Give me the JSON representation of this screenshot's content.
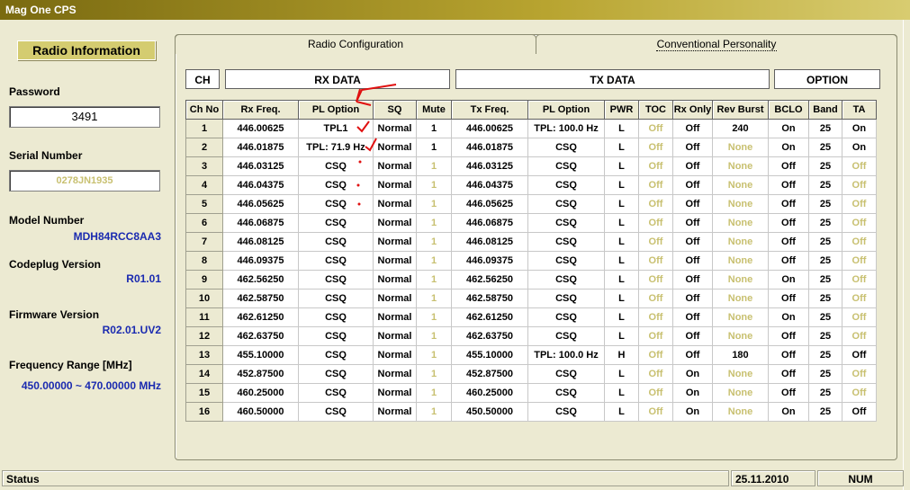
{
  "app": {
    "title": "Mag One CPS"
  },
  "sidebar": {
    "heading": "Radio Information",
    "password_label": "Password",
    "password_value": "3491",
    "serial_label": "Serial Number",
    "serial_value": "0278JN1935",
    "model_label": "Model Number",
    "model_value": "MDH84RCC8AA3",
    "codeplug_label": "Codeplug Version",
    "codeplug_value": "R01.01",
    "firmware_label": "Firmware Version",
    "firmware_value": "R02.01.UV2",
    "freq_label": "Frequency Range [MHz]",
    "freq_value": "450.00000 ~ 470.00000 MHz"
  },
  "tabs": {
    "radio_config": "Radio Configuration",
    "conv_personality": "Conventional Personality"
  },
  "groups": {
    "ch": "CH",
    "rx": "RX DATA",
    "tx": "TX DATA",
    "option": "OPTION"
  },
  "columns": [
    "Ch No",
    "Rx Freq.",
    "PL Option",
    "SQ",
    "Mute",
    "Tx Freq.",
    "PL Option",
    "PWR",
    "TOC",
    "Rx Only",
    "Rev Burst",
    "BCLO",
    "Band",
    "TA"
  ],
  "rows": [
    [
      "1",
      "446.00625",
      "TPL1",
      "Normal",
      "1",
      "446.00625",
      "TPL: 100.0 Hz",
      "L",
      "Off",
      "Off",
      "240",
      "On",
      "25",
      "On"
    ],
    [
      "2",
      "446.01875",
      "TPL: 71.9 Hz",
      "Normal",
      "1",
      "446.01875",
      "CSQ",
      "L",
      "Off",
      "Off",
      "None",
      "On",
      "25",
      "On"
    ],
    [
      "3",
      "446.03125",
      "CSQ",
      "Normal",
      "1",
      "446.03125",
      "CSQ",
      "L",
      "Off",
      "Off",
      "None",
      "Off",
      "25",
      "Off"
    ],
    [
      "4",
      "446.04375",
      "CSQ",
      "Normal",
      "1",
      "446.04375",
      "CSQ",
      "L",
      "Off",
      "Off",
      "None",
      "Off",
      "25",
      "Off"
    ],
    [
      "5",
      "446.05625",
      "CSQ",
      "Normal",
      "1",
      "446.05625",
      "CSQ",
      "L",
      "Off",
      "Off",
      "None",
      "Off",
      "25",
      "Off"
    ],
    [
      "6",
      "446.06875",
      "CSQ",
      "Normal",
      "1",
      "446.06875",
      "CSQ",
      "L",
      "Off",
      "Off",
      "None",
      "Off",
      "25",
      "Off"
    ],
    [
      "7",
      "446.08125",
      "CSQ",
      "Normal",
      "1",
      "446.08125",
      "CSQ",
      "L",
      "Off",
      "Off",
      "None",
      "Off",
      "25",
      "Off"
    ],
    [
      "8",
      "446.09375",
      "CSQ",
      "Normal",
      "1",
      "446.09375",
      "CSQ",
      "L",
      "Off",
      "Off",
      "None",
      "Off",
      "25",
      "Off"
    ],
    [
      "9",
      "462.56250",
      "CSQ",
      "Normal",
      "1",
      "462.56250",
      "CSQ",
      "L",
      "Off",
      "Off",
      "None",
      "On",
      "25",
      "Off"
    ],
    [
      "10",
      "462.58750",
      "CSQ",
      "Normal",
      "1",
      "462.58750",
      "CSQ",
      "L",
      "Off",
      "Off",
      "None",
      "Off",
      "25",
      "Off"
    ],
    [
      "11",
      "462.61250",
      "CSQ",
      "Normal",
      "1",
      "462.61250",
      "CSQ",
      "L",
      "Off",
      "Off",
      "None",
      "On",
      "25",
      "Off"
    ],
    [
      "12",
      "462.63750",
      "CSQ",
      "Normal",
      "1",
      "462.63750",
      "CSQ",
      "L",
      "Off",
      "Off",
      "None",
      "Off",
      "25",
      "Off"
    ],
    [
      "13",
      "455.10000",
      "CSQ",
      "Normal",
      "1",
      "455.10000",
      "TPL: 100.0 Hz",
      "H",
      "Off",
      "Off",
      "180",
      "Off",
      "25",
      "Off"
    ],
    [
      "14",
      "452.87500",
      "CSQ",
      "Normal",
      "1",
      "452.87500",
      "CSQ",
      "L",
      "Off",
      "On",
      "None",
      "Off",
      "25",
      "Off"
    ],
    [
      "15",
      "460.25000",
      "CSQ",
      "Normal",
      "1",
      "460.25000",
      "CSQ",
      "L",
      "Off",
      "On",
      "None",
      "Off",
      "25",
      "Off"
    ],
    [
      "16",
      "460.50000",
      "CSQ",
      "Normal",
      "1",
      "450.50000",
      "CSQ",
      "L",
      "Off",
      "On",
      "None",
      "On",
      "25",
      "Off"
    ]
  ],
  "dim_cells": [
    [
      false,
      false,
      false,
      false,
      false,
      false,
      false,
      false,
      true,
      false,
      false,
      false,
      false,
      false
    ],
    [
      false,
      false,
      false,
      false,
      false,
      false,
      false,
      false,
      true,
      false,
      true,
      false,
      false,
      false
    ],
    [
      false,
      false,
      false,
      false,
      true,
      false,
      false,
      false,
      true,
      false,
      true,
      false,
      false,
      true
    ],
    [
      false,
      false,
      false,
      false,
      true,
      false,
      false,
      false,
      true,
      false,
      true,
      false,
      false,
      true
    ],
    [
      false,
      false,
      false,
      false,
      true,
      false,
      false,
      false,
      true,
      false,
      true,
      false,
      false,
      true
    ],
    [
      false,
      false,
      false,
      false,
      true,
      false,
      false,
      false,
      true,
      false,
      true,
      false,
      false,
      true
    ],
    [
      false,
      false,
      false,
      false,
      true,
      false,
      false,
      false,
      true,
      false,
      true,
      false,
      false,
      true
    ],
    [
      false,
      false,
      false,
      false,
      true,
      false,
      false,
      false,
      true,
      false,
      true,
      false,
      false,
      true
    ],
    [
      false,
      false,
      false,
      false,
      true,
      false,
      false,
      false,
      true,
      false,
      true,
      false,
      false,
      true
    ],
    [
      false,
      false,
      false,
      false,
      true,
      false,
      false,
      false,
      true,
      false,
      true,
      false,
      false,
      true
    ],
    [
      false,
      false,
      false,
      false,
      true,
      false,
      false,
      false,
      true,
      false,
      true,
      false,
      false,
      true
    ],
    [
      false,
      false,
      false,
      false,
      true,
      false,
      false,
      false,
      true,
      false,
      true,
      false,
      false,
      true
    ],
    [
      false,
      false,
      false,
      false,
      true,
      false,
      false,
      false,
      true,
      false,
      false,
      false,
      false,
      false
    ],
    [
      false,
      false,
      false,
      false,
      true,
      false,
      false,
      false,
      true,
      false,
      true,
      false,
      false,
      true
    ],
    [
      false,
      false,
      false,
      false,
      true,
      false,
      false,
      false,
      true,
      false,
      true,
      false,
      false,
      true
    ],
    [
      false,
      false,
      false,
      false,
      true,
      false,
      false,
      false,
      true,
      false,
      true,
      false,
      false,
      false
    ]
  ],
  "colors": {
    "dim_text": "#c8c070",
    "value_blue": "#1a2ab0",
    "annotation_red": "#e01010"
  },
  "status": {
    "text": "Status",
    "date": "25.11.2010",
    "num": "NUM"
  }
}
